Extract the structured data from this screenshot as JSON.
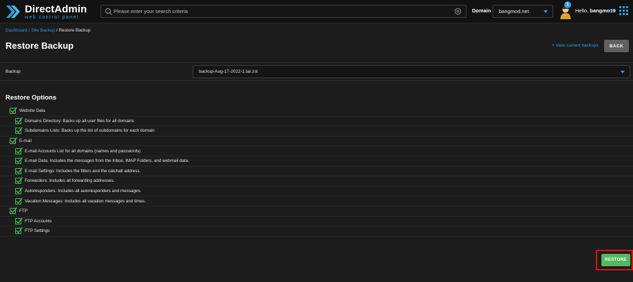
{
  "header": {
    "logo_title": "DirectAdmin",
    "logo_subtitle": "web control panel",
    "search": {
      "placeholder": "Please enter your search criteria"
    },
    "domain_label": "Domain",
    "domain_selected": "bangmod.net",
    "notification_count": "1",
    "greeting": "Hello,",
    "username": "bangmo19"
  },
  "breadcrumb": {
    "items": [
      "Dashboard",
      "Site Backup",
      "Restore Backup"
    ],
    "separator": " / "
  },
  "page": {
    "title": "Restore Backup",
    "view_link": "+ View current backups",
    "back_label": "BACK"
  },
  "backup": {
    "label": "Backup",
    "selected": "backup-Aug-17-2022-1.tar.zst"
  },
  "restore_options": {
    "title": "Restore Options",
    "items": [
      {
        "label": "Website Data",
        "level": 0,
        "checked": true
      },
      {
        "label": "Domains Directory: Backs up all user files for all domains",
        "level": 1,
        "checked": true
      },
      {
        "label": "Subdomains Lists: Backs up the list of subdomains for each domain",
        "level": 1,
        "checked": true
      },
      {
        "label": "E-mail",
        "level": 0,
        "checked": true
      },
      {
        "label": "E-mail Accounts List for all domains (names and passwords)",
        "level": 1,
        "checked": true
      },
      {
        "label": "E-mail Data: Includes the messages from the Inbox, IMAP Folders, and webmail data.",
        "level": 1,
        "checked": true
      },
      {
        "label": "E-mail Settings: Includes the filters and the catchall address.",
        "level": 1,
        "checked": true
      },
      {
        "label": "Forwarders: Includes all forwarding addresses.",
        "level": 1,
        "checked": true
      },
      {
        "label": "Autoresponders: Includes all autoresponders and messages.",
        "level": 1,
        "checked": true
      },
      {
        "label": "Vacation Messages: Includes all vacation messages and times.",
        "level": 1,
        "checked": true
      },
      {
        "label": "FTP",
        "level": 0,
        "checked": true
      },
      {
        "label": "FTP Accounts",
        "level": 1,
        "checked": true
      },
      {
        "label": "FTP Settings",
        "level": 1,
        "checked": true
      }
    ]
  },
  "actions": {
    "restore_label": "RESTORE"
  },
  "colors": {
    "accent": "#2b9fe0",
    "check": "#44c35a",
    "restore": "#56b962",
    "highlight": "#e01010",
    "background": "#1c1c1c"
  }
}
